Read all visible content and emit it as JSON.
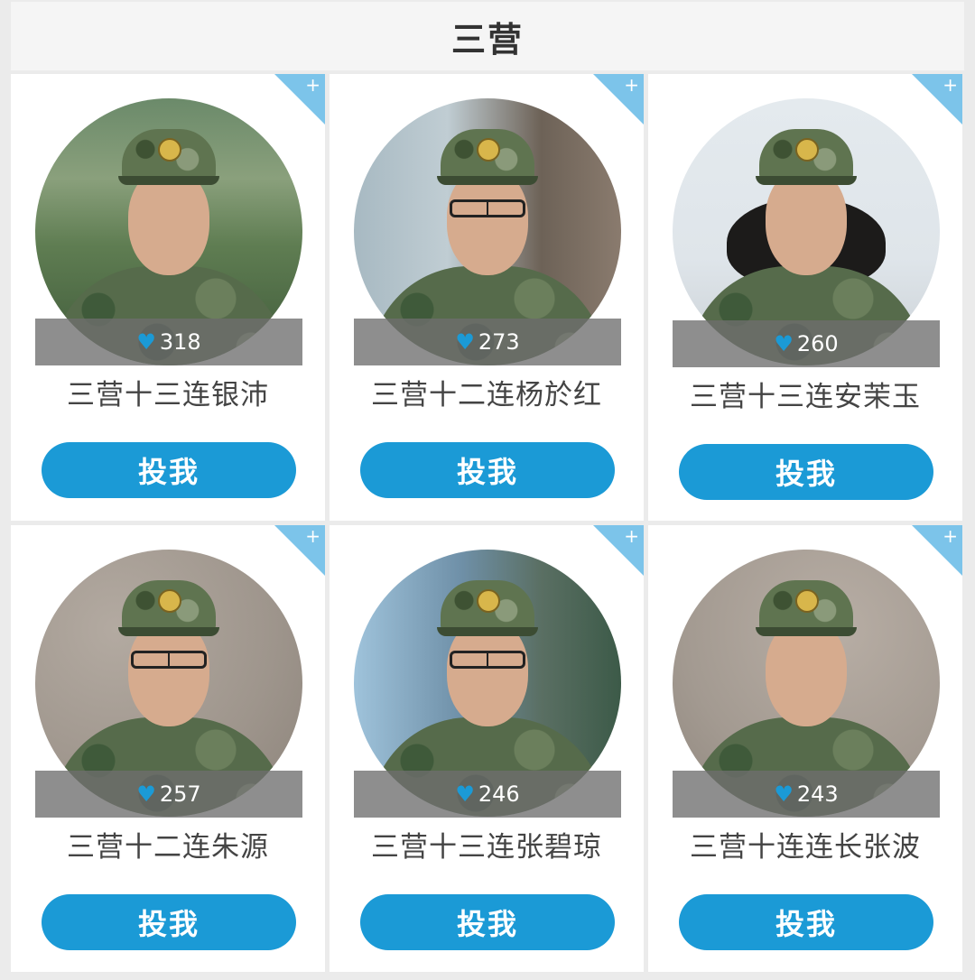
{
  "header": {
    "title": "三营"
  },
  "vote_label": "投我",
  "corner_icon": "+",
  "heart_icon": "♥",
  "accent_color": "#1b9ad6",
  "candidates": [
    {
      "name": "三营十三连银沛",
      "votes": "318",
      "glasses": false
    },
    {
      "name": "三营十二连杨於红",
      "votes": "273",
      "glasses": true
    },
    {
      "name": "三营十三连安茉玉",
      "votes": "260",
      "glasses": false
    },
    {
      "name": "三营十二连朱源",
      "votes": "257",
      "glasses": true
    },
    {
      "name": "三营十三连张碧琼",
      "votes": "246",
      "glasses": true
    },
    {
      "name": "三营十连连长张波",
      "votes": "243",
      "glasses": false
    }
  ]
}
